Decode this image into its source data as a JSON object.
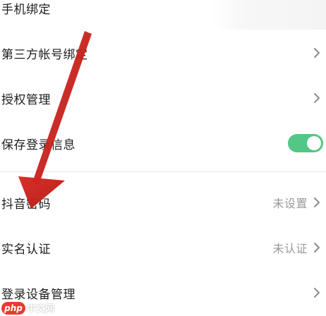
{
  "settings": {
    "items": [
      {
        "label": "手机绑定"
      },
      {
        "label": "第三方帐号绑定"
      },
      {
        "label": "授权管理"
      },
      {
        "label": "保存登录信息",
        "toggle": true
      },
      {
        "label": "抖音密码",
        "value": "未设置"
      },
      {
        "label": "实名认证",
        "value": "未认证"
      },
      {
        "label": "登录设备管理"
      }
    ]
  },
  "colors": {
    "toggle_on": "#53c785",
    "arrow": "#c8221c",
    "value_text": "#9a9a9a"
  },
  "icons": {
    "chevron": "chevron-right-icon",
    "annotation": "red-arrow"
  },
  "watermark": {
    "logo": "php",
    "text": "中文网"
  }
}
